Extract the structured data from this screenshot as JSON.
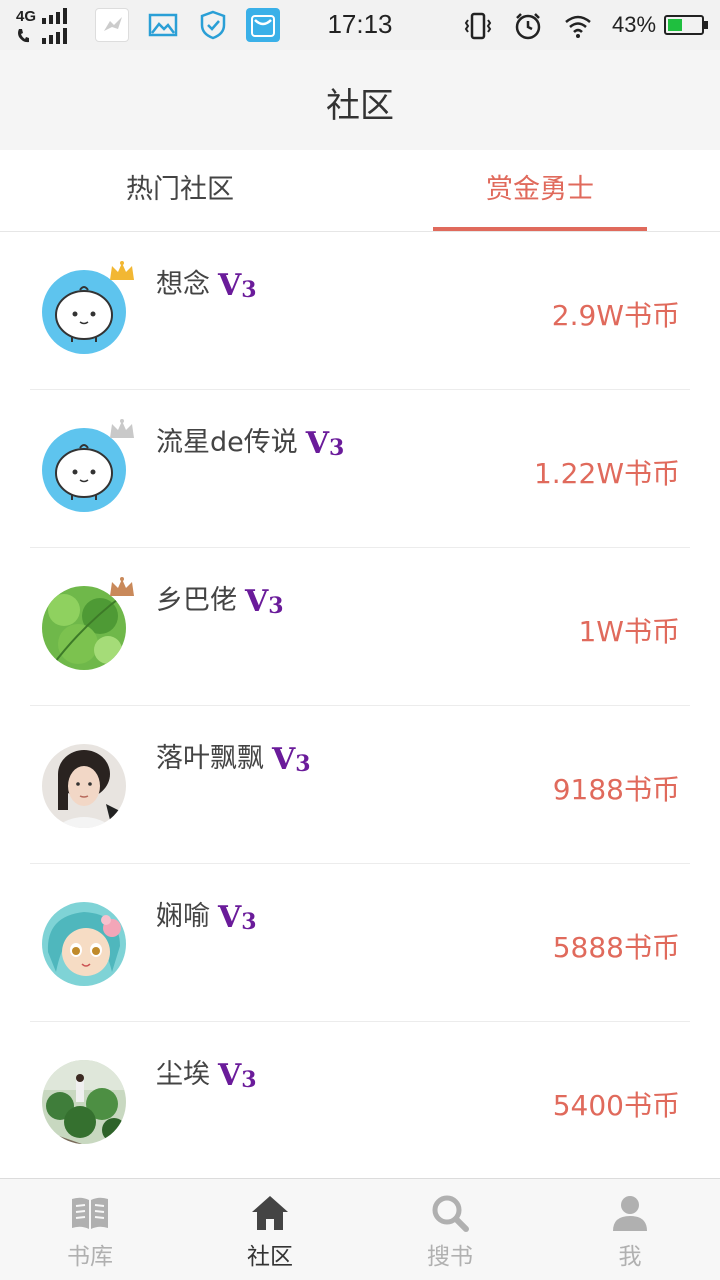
{
  "status_bar": {
    "network": "4G",
    "time": "17:13",
    "battery_percent": "43%",
    "battery_level": 0.43,
    "battery_color": "#1fbf3f",
    "icons": [
      "signal-icon",
      "phone-icon",
      "app-bird-icon",
      "gallery-icon",
      "shield-icon",
      "vivo-store-icon",
      "vibrate-icon",
      "alarm-icon",
      "wifi-icon",
      "battery-icon"
    ]
  },
  "header": {
    "title": "社区"
  },
  "tabs": [
    {
      "label": "热门社区",
      "active": false
    },
    {
      "label": "赏金勇士",
      "active": true
    }
  ],
  "accent_color": "#e06a5c",
  "vip_color": "#6a1b9a",
  "list": [
    {
      "name": "想念",
      "level_v": "V",
      "level_n": "3",
      "coins": "2.9W书币",
      "crown": "gold"
    },
    {
      "name": "流星de传说",
      "level_v": "V",
      "level_n": "3",
      "coins": "1.22W书币",
      "crown": "silver"
    },
    {
      "name": "乡巴佬",
      "level_v": "V",
      "level_n": "3",
      "coins": "1W书币",
      "crown": "bronze"
    },
    {
      "name": "落叶飘飘",
      "level_v": "V",
      "level_n": "3",
      "coins": "9188书币",
      "crown": "none"
    },
    {
      "name": "娴喻",
      "level_v": "V",
      "level_n": "3",
      "coins": "5888书币",
      "crown": "none"
    },
    {
      "name": "尘埃",
      "level_v": "V",
      "level_n": "3",
      "coins": "5400书币",
      "crown": "none"
    }
  ],
  "bottom_nav": [
    {
      "label": "书库",
      "icon": "book-icon",
      "active": false
    },
    {
      "label": "社区",
      "icon": "home-icon",
      "active": true
    },
    {
      "label": "搜书",
      "icon": "search-icon",
      "active": false
    },
    {
      "label": "我",
      "icon": "user-icon",
      "active": false
    }
  ]
}
